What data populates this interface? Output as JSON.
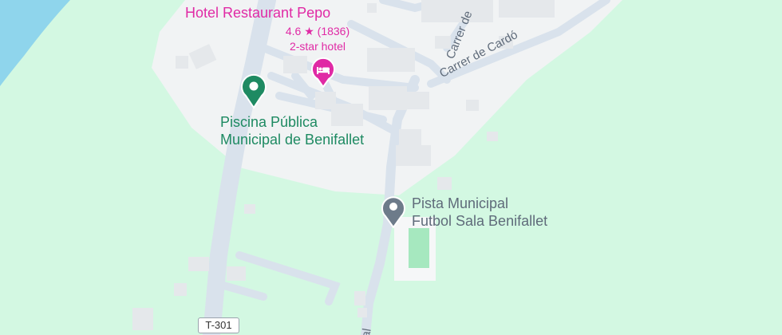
{
  "map": {
    "colors": {
      "water": "#8fd5ec",
      "park": "#d3f8e2",
      "town": "#f1f3f4",
      "road": "#ffffff",
      "major_road": "#d9e2ec",
      "building": "#e5e8eb",
      "sports_pitch": "#a6e8bf",
      "hotel_accent": "#e02aa5",
      "poi_green": "#1e8a62",
      "poi_gray": "#5f6b7a"
    },
    "pois": {
      "hotel": {
        "name": "Hotel Restaurant Pepo",
        "rating": "4.6 ★ (1836)",
        "type": "2-star hotel",
        "icon": "bed-icon"
      },
      "pool": {
        "line1": "Piscina Pública",
        "line2": "Municipal de Benifallet",
        "icon": "map-pin-icon"
      },
      "futsal": {
        "line1": "Pista Municipal",
        "line2": "Futbol Sala Benifallet",
        "icon": "map-pin-icon"
      }
    },
    "streets": {
      "carrer_cardo": "Carrer de Cardó",
      "carrer_partial": "Carrer de",
      "partial_bottom": "al"
    },
    "route_shield": "T-301"
  }
}
